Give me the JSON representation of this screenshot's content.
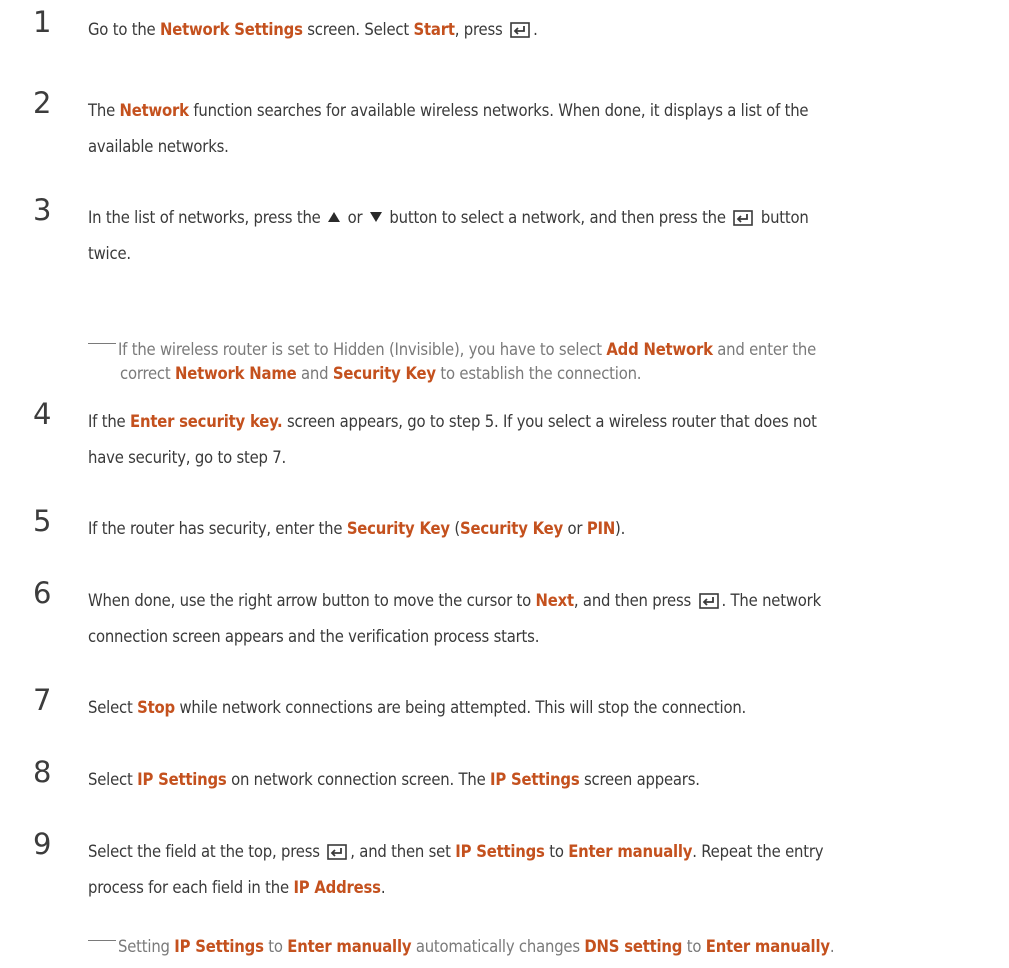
{
  "steps": [
    {
      "number": "1",
      "parts": [
        "Go to the ",
        "Network Settings",
        " screen. Select ",
        "Start",
        ", press ",
        "."
      ]
    },
    {
      "number": "2",
      "parts": [
        "The ",
        "Network",
        " function searches for available wireless networks. When done, it displays a list of the",
        "available networks."
      ]
    },
    {
      "number": "3",
      "parts": [
        "In the list of networks, press the ",
        " or ",
        " button to select a network, and then press the ",
        " button",
        "twice."
      ]
    },
    {
      "number": "4",
      "parts": [
        "If the ",
        "Enter security key.",
        " screen appears, go to step 5. If you select a wireless router that does not",
        "have security, go to step 7."
      ]
    },
    {
      "number": "5",
      "parts": [
        "If the router has security, enter the ",
        "Security Key",
        " (",
        "Security Key",
        " or ",
        "PIN",
        ")."
      ]
    },
    {
      "number": "6",
      "parts": [
        "When done, use the right arrow button to move the cursor to ",
        "Next",
        ", and then press ",
        ". The network",
        "connection screen appears and the verification process starts."
      ]
    },
    {
      "number": "7",
      "parts": [
        "Select ",
        "Stop",
        " while network connections are being attempted. This will stop the connection."
      ]
    },
    {
      "number": "8",
      "parts": [
        "Select ",
        "IP Settings",
        " on network connection screen. The ",
        "IP Settings",
        " screen appears."
      ]
    },
    {
      "number": "9",
      "parts": [
        "Select the field at the top, press ",
        ", and then set ",
        "IP Settings",
        " to ",
        "Enter manually",
        ". Repeat the entry",
        "process for each field in the ",
        "IP Address",
        "."
      ]
    }
  ],
  "notes": [
    {
      "parts": [
        "If the wireless router is set to Hidden (Invisible), you have to select ",
        "Add Network",
        " and enter the",
        "correct ",
        "Network Name",
        " and ",
        "Security Key",
        " to establish the connection."
      ]
    },
    {
      "parts": [
        "Setting ",
        "IP Settings",
        " to ",
        "Enter manually",
        " automatically changes ",
        "DNS setting",
        " to ",
        "Enter manually",
        "."
      ]
    }
  ],
  "colors": {
    "highlight": "#c4511e",
    "text": "#3a3a3a",
    "note": "#7a7a7a"
  },
  "icons": {
    "enter": "enter-icon",
    "up": "up-triangle-icon",
    "down": "down-triangle-icon"
  }
}
